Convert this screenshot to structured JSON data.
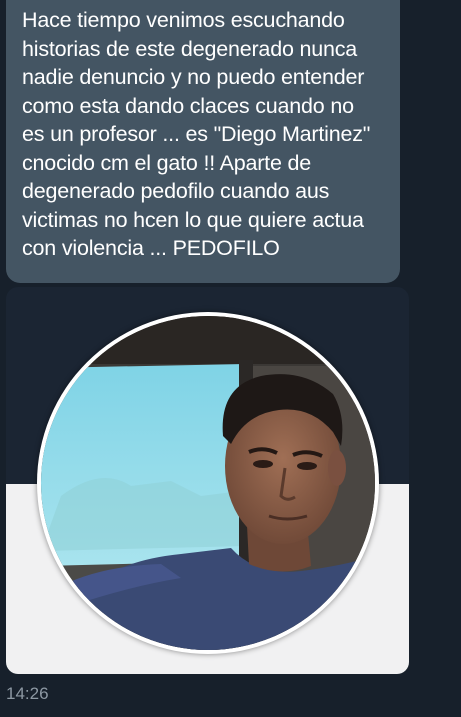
{
  "chat": {
    "message": {
      "text": "Hace tiempo venimos escuchando\nhistorias de este degenerado nunca\nnadie denuncio y no puedo entender\ncomo esta dando claces cuando no\nes un profesor ... es \"Diego Martinez\"\ncnocido cm el gato !! Aparte de\ndegenerado pedofilo cuando aus\nvictimas no hcen lo que quiere actua\ncon violencia ... PEDOFILO"
    },
    "image_message": {
      "icon": "profile-photo"
    },
    "timestamp": "14:26"
  },
  "colors": {
    "background": "#17202b",
    "bubble": "#445563",
    "card_light": "#f1f1f2",
    "timestamp": "#8d98a3"
  }
}
